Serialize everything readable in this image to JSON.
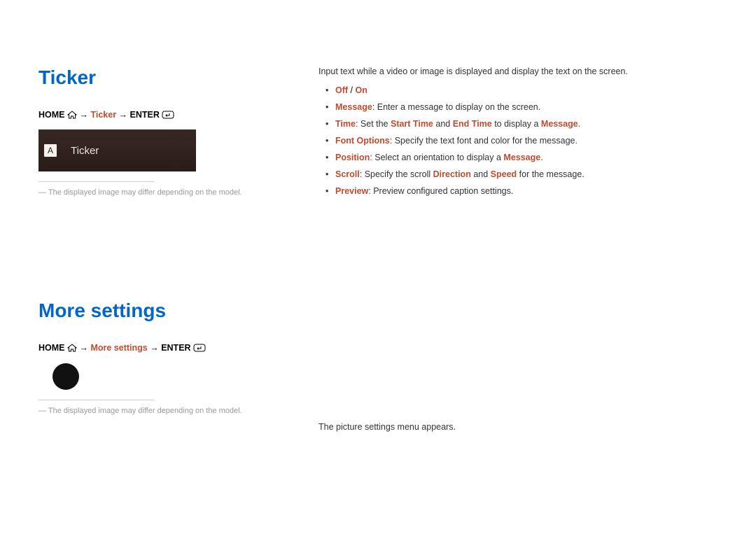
{
  "section1": {
    "heading": "Ticker",
    "nav": {
      "home": "HOME",
      "mid": "Ticker",
      "enter": "ENTER",
      "arrow": "→"
    },
    "box": {
      "letter": "A",
      "label": "Ticker"
    },
    "note": "The displayed image may differ depending on the model.",
    "intro": "Input text while a video or image is displayed and display the text on the screen.",
    "bullets": {
      "b1": {
        "k1": "Off",
        "sep": " / ",
        "k2": "On"
      },
      "b2": {
        "k": "Message",
        "t": ": Enter a message to display on the screen."
      },
      "b3": {
        "k1": "Time",
        "t1": ": Set the ",
        "k2": "Start Time",
        "t2": " and ",
        "k3": "End Time",
        "t3": " to display a ",
        "k4": "Message",
        "t4": "."
      },
      "b4": {
        "k": "Font Options",
        "t": ": Specify the text font and color for the message."
      },
      "b5": {
        "k1": "Position",
        "t1": ": Select an orientation to display a ",
        "k2": "Message",
        "t2": "."
      },
      "b6": {
        "k1": "Scroll",
        "t1": ": Specify the scroll ",
        "k2": "Direction",
        "t2": " and ",
        "k3": "Speed",
        "t3": " for the message."
      },
      "b7": {
        "k": "Preview",
        "t": ": Preview configured caption settings."
      }
    }
  },
  "section2": {
    "heading": "More settings",
    "nav": {
      "home": "HOME",
      "mid": "More settings",
      "enter": "ENTER",
      "arrow": "→"
    },
    "note": "The displayed image may differ depending on the model.",
    "text": "The picture settings menu appears."
  }
}
